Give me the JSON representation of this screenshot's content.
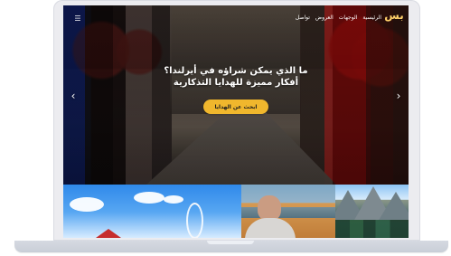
{
  "device": {
    "type": "laptop"
  },
  "header": {
    "menu_icon": "menu-icon",
    "nav_items": [
      "الرئيسية",
      "الوجهات",
      "العروض",
      "تواصل"
    ],
    "brand_mark": "بس"
  },
  "hero": {
    "title": "ما الذي يمكن شراؤه في أيرلندا؟ أفكار مميزة للهدايا التذكارية",
    "cta_label": "ابحث عن الهدايا"
  },
  "gallery": {
    "items": [
      "sky-eye",
      "lake-person",
      "mountain-lake"
    ]
  }
}
